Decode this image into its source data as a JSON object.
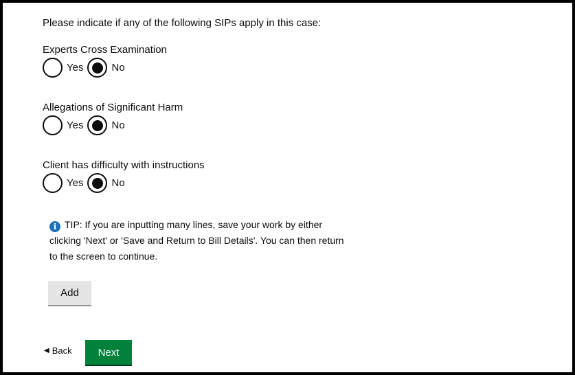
{
  "intro_text": "Please indicate if any of the following SIPs apply in this case:",
  "questions": [
    {
      "label": "Experts Cross Examination",
      "options": [
        {
          "label": "Yes",
          "checked": false
        },
        {
          "label": "No",
          "checked": true
        }
      ]
    },
    {
      "label": "Allegations of Significant Harm",
      "options": [
        {
          "label": "Yes",
          "checked": false
        },
        {
          "label": "No",
          "checked": true
        }
      ]
    },
    {
      "label": "Client has difficulty with instructions",
      "options": [
        {
          "label": "Yes",
          "checked": false
        },
        {
          "label": "No",
          "checked": true
        }
      ]
    }
  ],
  "tip": {
    "icon": "info-icon",
    "text": "TIP: If you are inputting many lines, save your work by either clicking 'Next' or 'Save and Return to Bill Details'. You can then return to the screen to continue."
  },
  "add_button_label": "Add",
  "back_link_label": "Back",
  "next_button_label": "Next",
  "colors": {
    "next_button": "#00823b",
    "add_button": "#e5e5e5",
    "info_icon": "#1d70b8",
    "frame_border": "#000000"
  }
}
